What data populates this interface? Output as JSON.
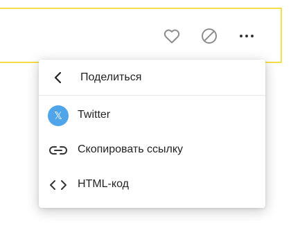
{
  "player_bar": {
    "focus_border_color": "#f5dd4b",
    "like_icon": "heart-icon",
    "block_icon": "block-icon",
    "more_icon": "more-dots-icon"
  },
  "share_menu": {
    "title": "Поделиться",
    "back_icon": "chevron-left-icon",
    "items": [
      {
        "label": "Twitter",
        "icon": "twitter-x-icon",
        "icon_bg": "#50a4ea",
        "icon_glyph": "𝕏"
      },
      {
        "label": "Скопировать ссылку",
        "icon": "link-icon"
      },
      {
        "label": "HTML-код",
        "icon": "code-icon"
      }
    ]
  }
}
